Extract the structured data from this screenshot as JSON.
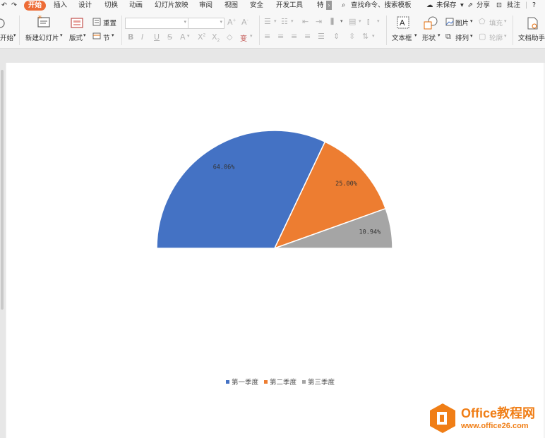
{
  "menu": {
    "tabs": [
      "开始",
      "插入",
      "设计",
      "切换",
      "动画",
      "幻灯片放映",
      "审阅",
      "视图",
      "安全",
      "开发工具",
      "特"
    ],
    "search_label": "查找命令、搜索模板",
    "save_status": "未保存",
    "share_label": "分享",
    "comment_label": "批注",
    "help_label": "?"
  },
  "ribbon": {
    "start_label": "开始",
    "new_slide_label": "新建幻灯片",
    "layout_label": "版式",
    "reset_label": "重置",
    "section_label": "节",
    "textbox_label": "文本框",
    "shape_label": "形状",
    "picture_label": "图片",
    "arrange_label": "排列",
    "fill_label": "填充",
    "outline_label": "轮廓",
    "doc_helper_label": "文档助手"
  },
  "chart_data": {
    "type": "pie",
    "subtype": "half-pie",
    "categories": [
      "第一季度",
      "第二季度",
      "第三季度"
    ],
    "values": [
      64.06,
      25.0,
      10.94
    ],
    "data_labels": [
      "64.06%",
      "25.00%",
      "10.94%"
    ],
    "colors": [
      "#4472c4",
      "#ed7d31",
      "#a5a5a5"
    ],
    "legend_position": "bottom",
    "title": ""
  },
  "watermark": {
    "title": "Office教程网",
    "url": "www.office26.com"
  }
}
